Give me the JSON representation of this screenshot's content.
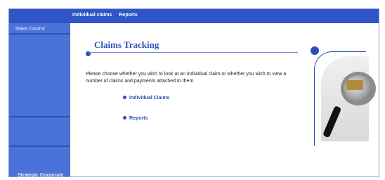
{
  "topbar": {
    "nav": [
      {
        "label": "Individual claims"
      },
      {
        "label": "Reports"
      }
    ]
  },
  "sidebar": {
    "top_label": "Make Control",
    "bottom_label": "Strategic Corporate"
  },
  "main": {
    "title": "Claims Tracking",
    "description": "Please choose whether you wish to look at an individual claim or whether you wish to view a number of claims and payments attached to them.",
    "links": [
      {
        "label": "Individual Claims"
      },
      {
        "label": "Reports"
      }
    ]
  },
  "colors": {
    "topbar": "#2f55c6",
    "sidebar": "#4a72d8",
    "accent": "#2c4eb7"
  }
}
